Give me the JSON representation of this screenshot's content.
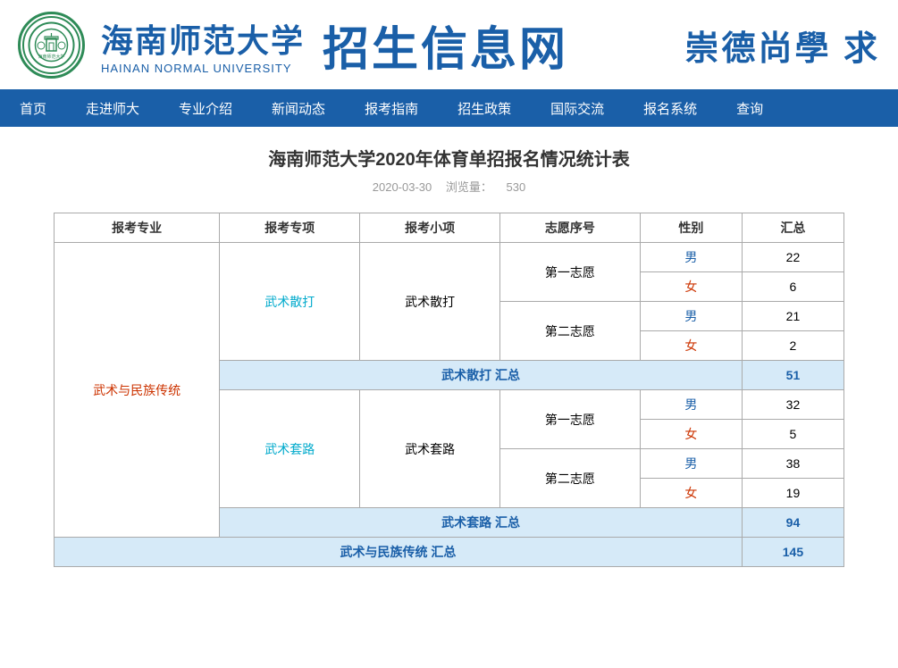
{
  "header": {
    "school_name_cn": "海南师范大学",
    "school_name_en": "HAINAN NORMAL UNIVERSITY",
    "site_title": "招生信息网",
    "header_right": "崇德尚學 求",
    "logo_text": "海南师范大学"
  },
  "nav": {
    "items": [
      "首页",
      "走进师大",
      "专业介绍",
      "新闻动态",
      "报考指南",
      "招生政策",
      "国际交流",
      "报名系统",
      "查询"
    ]
  },
  "page": {
    "title": "海南师范大学2020年体育单招报名情况统计表",
    "date": "2020-03-30",
    "views_label": "浏览量：",
    "views_count": "530"
  },
  "table": {
    "headers": [
      "报考专业",
      "报考专项",
      "报考小项",
      "志愿序号",
      "性别",
      "汇总"
    ],
    "rows": [
      {
        "major": "武术与民族传统",
        "sub": "武术散打",
        "small": "武术散打",
        "wish": "第一志愿",
        "gender": "男",
        "total": "22"
      },
      {
        "major": "",
        "sub": "",
        "small": "",
        "wish": "",
        "gender": "女",
        "total": "6"
      },
      {
        "major": "",
        "sub": "",
        "small": "",
        "wish": "第二志愿",
        "gender": "男",
        "total": "21"
      },
      {
        "major": "",
        "sub": "",
        "small": "",
        "wish": "",
        "gender": "女",
        "total": "2"
      },
      {
        "major": "",
        "sub": "",
        "small": "",
        "wish": "",
        "gender": "",
        "total": "51",
        "summary": true,
        "label": "武术散打 汇总"
      },
      {
        "major": "",
        "sub": "武术套路",
        "small": "武术套路",
        "wish": "第一志愿",
        "gender": "男",
        "total": "32"
      },
      {
        "major": "",
        "sub": "",
        "small": "",
        "wish": "",
        "gender": "女",
        "total": "5"
      },
      {
        "major": "",
        "sub": "",
        "small": "",
        "wish": "第二志愿",
        "gender": "男",
        "total": "38"
      },
      {
        "major": "",
        "sub": "",
        "small": "",
        "wish": "",
        "gender": "女",
        "total": "19"
      },
      {
        "major": "",
        "sub": "",
        "small": "",
        "wish": "",
        "gender": "",
        "total": "94",
        "summary": true,
        "label": "武术套路 汇总"
      },
      {
        "major": "",
        "sub": "",
        "small": "",
        "wish": "",
        "gender": "",
        "total": "145",
        "summary": true,
        "label": "武术与民族传统 汇总",
        "bottom": true
      }
    ]
  }
}
